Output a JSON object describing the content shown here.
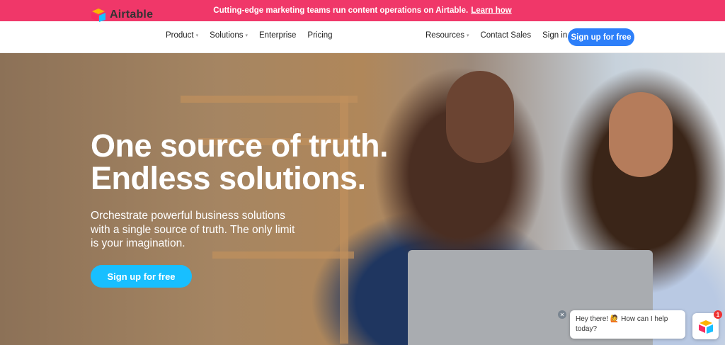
{
  "promo": {
    "text": "Cutting-edge marketing teams run content operations on Airtable.",
    "link": "Learn how"
  },
  "nav": {
    "logo_text": "Airtable",
    "left_items": [
      {
        "label": "Product",
        "has_dropdown": true
      },
      {
        "label": "Solutions",
        "has_dropdown": true
      },
      {
        "label": "Enterprise",
        "has_dropdown": false
      },
      {
        "label": "Pricing",
        "has_dropdown": false
      }
    ],
    "right_items": [
      {
        "label": "Resources",
        "has_dropdown": true
      },
      {
        "label": "Contact Sales",
        "has_dropdown": false
      },
      {
        "label": "Sign in",
        "has_dropdown": false
      }
    ],
    "signup_label": "Sign up for free"
  },
  "hero": {
    "headline_line1": "One source of truth.",
    "headline_line2": "Endless solutions.",
    "subhead": "Orchestrate powerful business solutions with a single source of truth. The only limit is your imagination.",
    "cta_label": "Sign up for free"
  },
  "chat": {
    "close_glyph": "✕",
    "message": "Hey there! 🙋 How can I help today?",
    "badge_count": "1"
  },
  "colors": {
    "promo_bg": "#f03769",
    "nav_cta": "#2d7ff9",
    "hero_cta": "#18bfff"
  }
}
